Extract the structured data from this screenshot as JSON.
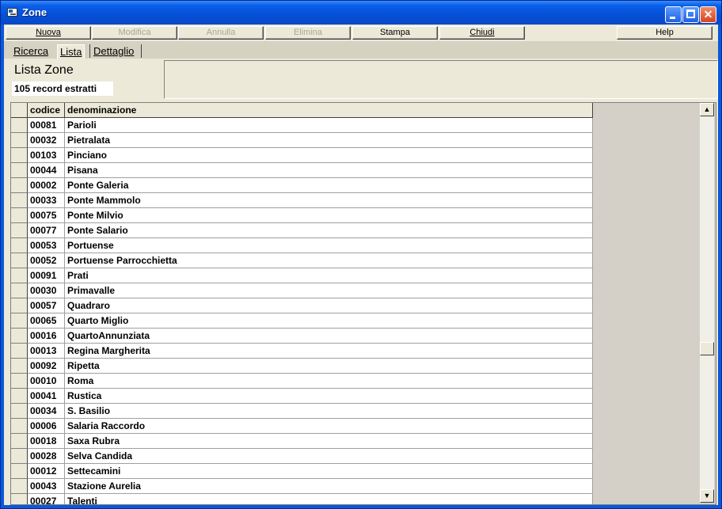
{
  "window": {
    "title": "Zone"
  },
  "toolbar": {
    "nuova": "Nuova",
    "modifica": "Modifica",
    "annulla": "Annulla",
    "elimina": "Elimina",
    "stampa": "Stampa",
    "chiudi": "Chiudi",
    "help": "Help"
  },
  "tabs": {
    "ricerca": "Ricerca",
    "lista": "Lista",
    "dettaglio": "Dettaglio"
  },
  "header": {
    "title": "Lista Zone",
    "record_count": "105 record estratti"
  },
  "grid": {
    "columns": {
      "codice": "codice",
      "denominazione": "denominazione"
    },
    "rows": [
      {
        "codice": "00081",
        "denominazione": "Parioli"
      },
      {
        "codice": "00032",
        "denominazione": "Pietralata"
      },
      {
        "codice": "00103",
        "denominazione": "Pinciano"
      },
      {
        "codice": "00044",
        "denominazione": "Pisana"
      },
      {
        "codice": "00002",
        "denominazione": "Ponte Galeria"
      },
      {
        "codice": "00033",
        "denominazione": "Ponte Mammolo"
      },
      {
        "codice": "00075",
        "denominazione": "Ponte Milvio"
      },
      {
        "codice": "00077",
        "denominazione": "Ponte Salario"
      },
      {
        "codice": "00053",
        "denominazione": "Portuense"
      },
      {
        "codice": "00052",
        "denominazione": "Portuense Parrocchietta"
      },
      {
        "codice": "00091",
        "denominazione": "Prati"
      },
      {
        "codice": "00030",
        "denominazione": "Primavalle"
      },
      {
        "codice": "00057",
        "denominazione": "Quadraro"
      },
      {
        "codice": "00065",
        "denominazione": "Quarto Miglio"
      },
      {
        "codice": "00016",
        "denominazione": "QuartoAnnunziata"
      },
      {
        "codice": "00013",
        "denominazione": "Regina Margherita"
      },
      {
        "codice": "00092",
        "denominazione": "Ripetta"
      },
      {
        "codice": "00010",
        "denominazione": "Roma"
      },
      {
        "codice": "00041",
        "denominazione": "Rustica"
      },
      {
        "codice": "00034",
        "denominazione": "S. Basilio"
      },
      {
        "codice": "00006",
        "denominazione": "Salaria Raccordo"
      },
      {
        "codice": "00018",
        "denominazione": "Saxa Rubra"
      },
      {
        "codice": "00028",
        "denominazione": "Selva Candida"
      },
      {
        "codice": "00012",
        "denominazione": "Settecamini"
      },
      {
        "codice": "00043",
        "denominazione": "Stazione Aurelia"
      },
      {
        "codice": "00027",
        "denominazione": "Talenti"
      }
    ]
  },
  "colors": {
    "titlebar": "#0a5fe8",
    "face": "#ece9d8",
    "disabled_text": "#a8a59a"
  }
}
